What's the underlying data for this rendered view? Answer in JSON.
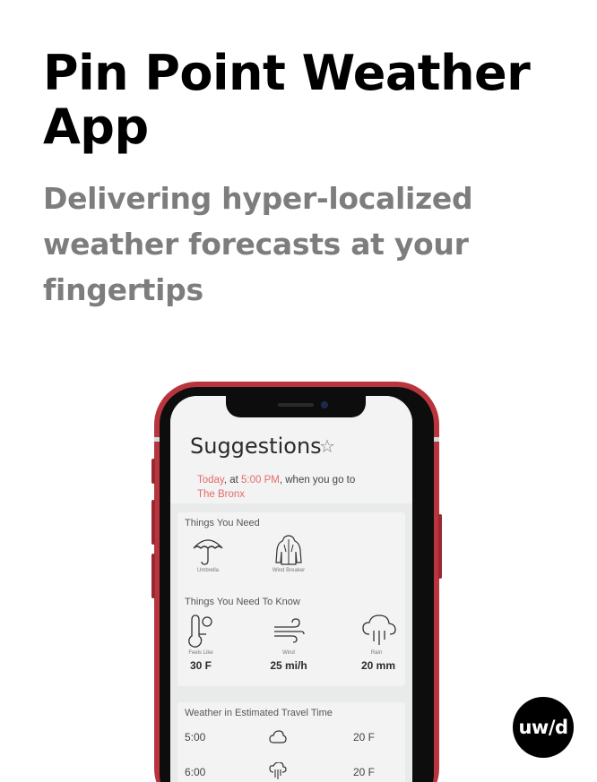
{
  "header": {
    "title": "Pin Point Weather App",
    "subtitle": "Delivering hyper-localized weather forecasts at your fingertips"
  },
  "app": {
    "heading": "Suggestions",
    "context": {
      "today": "Today",
      "at": ", at ",
      "time": "5:00 PM",
      "when": ", when you go to",
      "place": "The Bronx"
    },
    "needs_title": "Things You Need",
    "needs": [
      {
        "label": "Umbrella",
        "icon": "umbrella-icon"
      },
      {
        "label": "Wind Breaker",
        "icon": "jacket-icon"
      }
    ],
    "know_title": "Things You Need To Know",
    "know": [
      {
        "label": "Feels Like",
        "value": "30 F",
        "icon": "thermometer-icon"
      },
      {
        "label": "Wind",
        "value": "25 mi/h",
        "icon": "wind-icon"
      },
      {
        "label": "Rain",
        "value": "20 mm",
        "icon": "rain-icon"
      }
    ],
    "travel_title": "Weather in Estimated Travel Time",
    "travel": [
      {
        "time": "5:00",
        "temp": "20 F",
        "icon": "cloud-icon"
      },
      {
        "time": "6:00",
        "temp": "20 F",
        "icon": "cloud-rain-icon"
      }
    ],
    "colors": {
      "accent": "#e36b6b",
      "phone": "#b8353d"
    }
  },
  "logo": {
    "text": "uw/d"
  }
}
